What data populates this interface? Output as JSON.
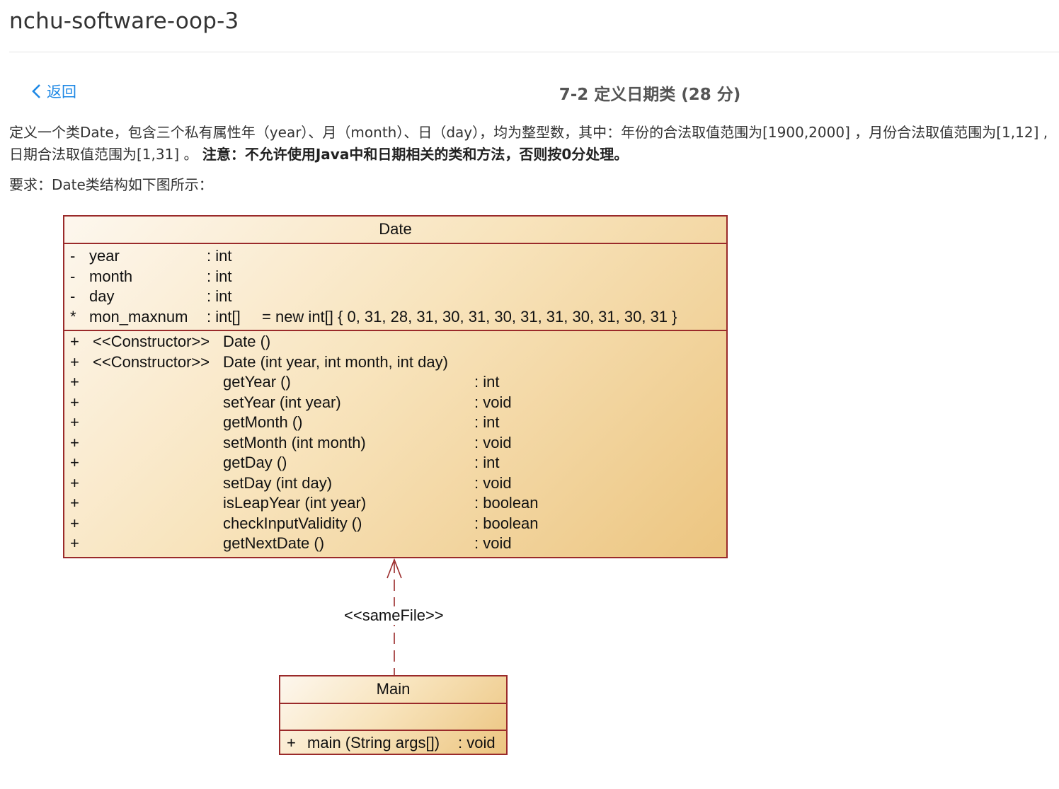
{
  "header": {
    "title": "nchu-software-oop-3"
  },
  "nav": {
    "back_label": "返回"
  },
  "problem": {
    "title": "7-2 定义日期类 (28 分)",
    "desc_plain": "定义一个类Date，包含三个私有属性年（year）、月（month）、日（day），均为整型数，其中：年份的合法取值范围为[1900,2000] ，月份合法取值范围为[1,12] ,日期合法取值范围为[1,31] 。 ",
    "desc_bold": "注意：不允许使用Java中和日期相关的类和方法，否则按0分处理。",
    "requirement": "要求：Date类结构如下图所示："
  },
  "uml": {
    "date_class": {
      "name": "Date",
      "attributes": [
        {
          "vis": "-",
          "name": "year",
          "type": ": int",
          "init": ""
        },
        {
          "vis": "-",
          "name": "month",
          "type": ": int",
          "init": ""
        },
        {
          "vis": "-",
          "name": "day",
          "type": ": int",
          "init": ""
        },
        {
          "vis": "*",
          "name": "mon_maxnum",
          "type": ": int[]",
          "init": "= new int[] { 0, 31, 28, 31, 30, 31, 30, 31, 31, 30, 31, 30, 31 }"
        }
      ],
      "operations": [
        {
          "vis": "+",
          "stereo": "<<Constructor>>",
          "name": "Date ()",
          "ret": ""
        },
        {
          "vis": "+",
          "stereo": "<<Constructor>>",
          "name": "Date (int year, int month, int day)",
          "ret": ""
        },
        {
          "vis": "+",
          "stereo": "",
          "name": "getYear ()",
          "ret": ": int"
        },
        {
          "vis": "+",
          "stereo": "",
          "name": "setYear (int year)",
          "ret": ": void"
        },
        {
          "vis": "+",
          "stereo": "",
          "name": "getMonth ()",
          "ret": ": int"
        },
        {
          "vis": "+",
          "stereo": "",
          "name": "setMonth (int month)",
          "ret": ": void"
        },
        {
          "vis": "+",
          "stereo": "",
          "name": "getDay ()",
          "ret": ": int"
        },
        {
          "vis": "+",
          "stereo": "",
          "name": "setDay (int day)",
          "ret": ": void"
        },
        {
          "vis": "+",
          "stereo": "",
          "name": "isLeapYear (int year)",
          "ret": ": boolean"
        },
        {
          "vis": "+",
          "stereo": "",
          "name": "checkInputValidity ()",
          "ret": ": boolean"
        },
        {
          "vis": "+",
          "stereo": "",
          "name": "getNextDate ()",
          "ret": ": void"
        }
      ]
    },
    "relation": {
      "label": "<<sameFile>>"
    },
    "main_class": {
      "name": "Main",
      "operations": [
        {
          "vis": "+",
          "name": "main (String args[])",
          "ret": ": void"
        }
      ]
    }
  },
  "colors": {
    "link": "#1e88e5",
    "uml_border": "#9a2a2a",
    "uml_fill_light": "#fdf7ee",
    "uml_fill_dark": "#ecc580"
  }
}
